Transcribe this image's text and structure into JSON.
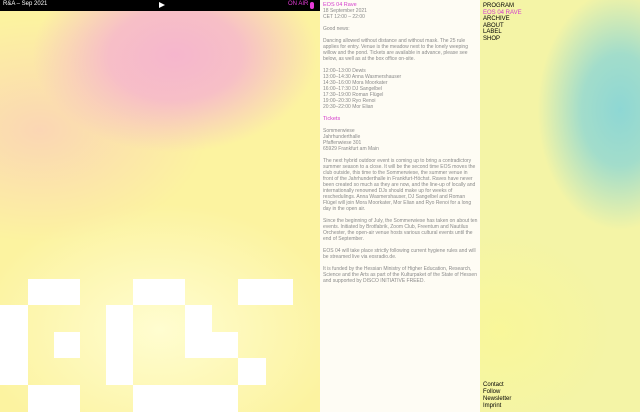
{
  "player": {
    "title": "R&A – Sep 2021",
    "on_air": "ON AIR",
    "icons": {
      "play": "play-icon",
      "mic": "microphone-icon"
    },
    "accent": "#e53bd8"
  },
  "article": {
    "title": "EOS 04 Rave",
    "date": "18 September 2021",
    "time": "CET 12:00 – 22:00",
    "intro": "Good news:",
    "paragraph1": "Dancing allowed without distance and without mask. The 25 rule applies for entry. Venue is the meadow next to the lonely weeping willow and the pond. Tickets are available in advance, please see below, as well as at the box office on-site.",
    "schedule": [
      "12:00–13:00 Dewis",
      "13:00–14:30 Anna Wasmershauser",
      "14:30–16:00 Mora Moorkater",
      "16:00–17:30 DJ Sangelbel",
      "17:30–19:00 Roman Flügel",
      "19:00–20:30 Ryo Renoi",
      "20:30–22:00 Mor Elian"
    ],
    "tickets_label": "Tickets",
    "address": [
      "Sommerwiese",
      "Jahrhunderthalle",
      "Pfaffenwiese 301",
      "65929 Frankfurt am Main"
    ],
    "paragraph2": "The next hybrid outdoor event is coming up to bring a contradictory summer season to a close. It will be the second time EOS moves the club outside, this time to the Sommerwiese, the summer venue in front of the Jahrhunderthalle in Frankfurt-Höchst. Raves have never been created so much as they are now, and the line-up of locally and internationally renowned DJs should make up for weeks of reschedulings. Anna Wasmershauser, DJ Sangelbel and Roman Flügel will join Mora Moorkater, Mor Elian and Ryo Renoi for a long day in the open air.",
    "paragraph3": "Since the beginning of July, the Sommerwiese has taken on about ten events. Initiated by Brotfabrik, Zoom Club, Freentum and Nautilus Orchester, the open-air venue hosts various cultural events until the end of September.",
    "paragraph4": "EOS 04 will take place strictly following current hygiene rules and will be streamed live via eosradio.de.",
    "paragraph5": "It is funded by the Hessian Ministry of Higher Education, Research, Science and the Arts as part of the Kulturpaket of the State of Hessen and supported by DISCO INITIATIVE FREED."
  },
  "nav": {
    "items": [
      "PROGRAM",
      "EOS 04 RAVE",
      "ARCHIVE",
      "ABOUT",
      "LABEL",
      "SHOP"
    ],
    "active_index": 1,
    "footer": [
      "Contact",
      "Follow",
      "Newsletter",
      "Imprint"
    ],
    "active_color": "#d43bcc"
  }
}
